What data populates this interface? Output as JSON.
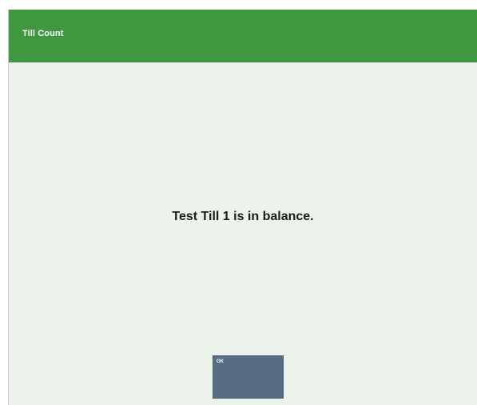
{
  "window": {
    "title": "Till Count"
  },
  "message": {
    "text": "Test Till 1 is in balance."
  },
  "buttons": {
    "ok_label": "OK"
  },
  "colors": {
    "titlebar": "#3f9840",
    "background": "#ebf3eb",
    "button": "#566d84",
    "text": "#1b1b1b"
  }
}
